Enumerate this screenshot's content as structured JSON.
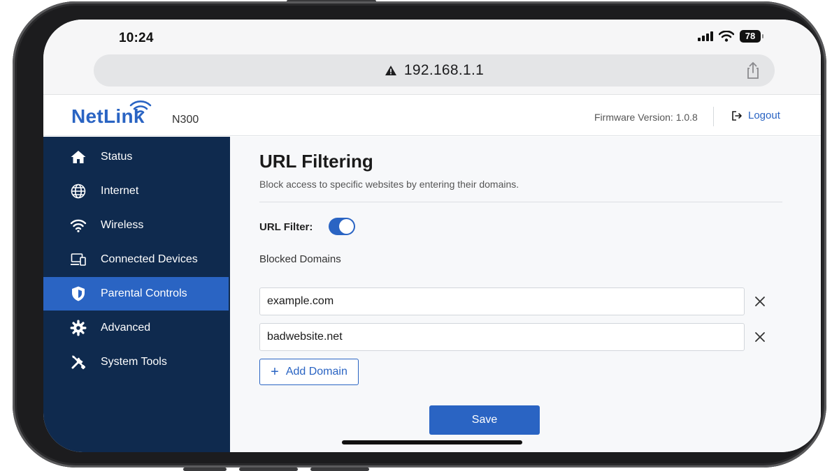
{
  "status_bar": {
    "time": "10:24",
    "battery": "78"
  },
  "browser": {
    "url": "192.168.1.1",
    "security_icon": "warning-triangle-icon",
    "share_icon": "share-icon"
  },
  "header": {
    "brand": "NetLink",
    "model": "N300",
    "firmware": "Firmware Version: 1.0.8",
    "logout_label": "Logout"
  },
  "sidebar": {
    "items": [
      {
        "label": "Status",
        "icon": "home-icon",
        "active": false
      },
      {
        "label": "Internet",
        "icon": "globe-icon",
        "active": false
      },
      {
        "label": "Wireless",
        "icon": "wifi-icon",
        "active": false
      },
      {
        "label": "Connected Devices",
        "icon": "devices-icon",
        "active": false
      },
      {
        "label": "Parental Controls",
        "icon": "shield-icon",
        "active": true
      },
      {
        "label": "Advanced",
        "icon": "gear-icon",
        "active": false
      },
      {
        "label": "System Tools",
        "icon": "tools-icon",
        "active": false
      }
    ]
  },
  "main": {
    "title": "URL Filtering",
    "description": "Block access to specific websites by entering their domains.",
    "filter_label": "URL Filter:",
    "filter_enabled": true,
    "blocked_label": "Blocked Domains",
    "domains": [
      "example.com",
      "badwebsite.net"
    ],
    "add_label": "Add Domain",
    "add_symbol": "+",
    "save_label": "Save"
  },
  "colors": {
    "accent": "#2a64c3",
    "sidebar_bg": "#0f2a4e",
    "main_bg": "#f7f8fa"
  }
}
